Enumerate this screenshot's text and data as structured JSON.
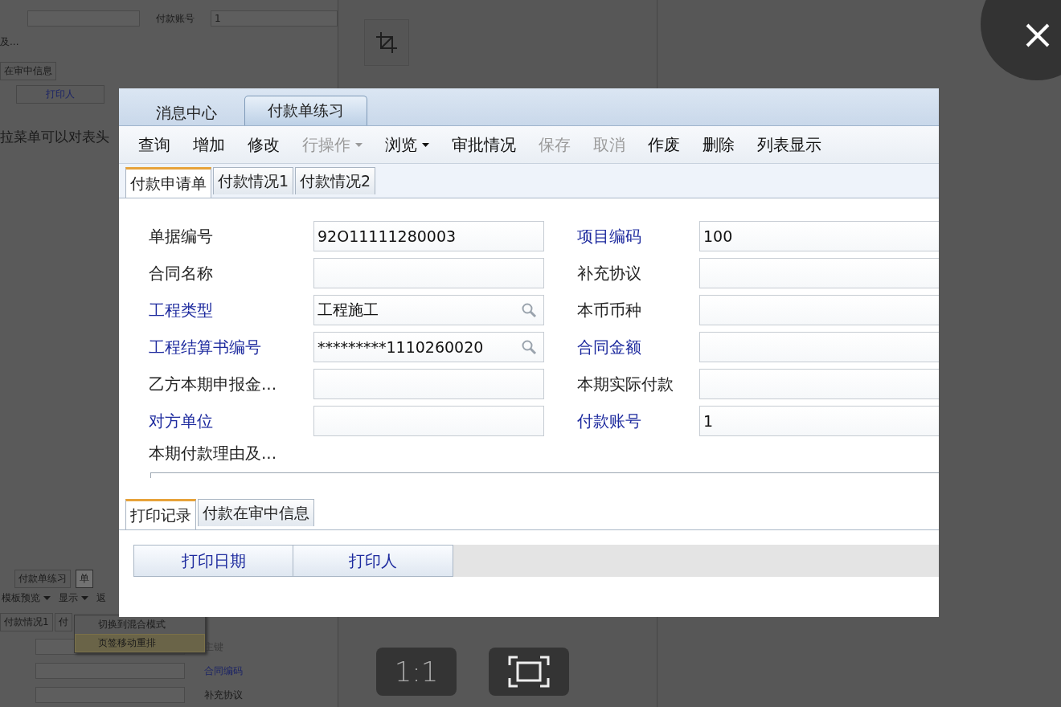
{
  "background_page": {
    "account_label": "付款账号",
    "account_value": "1",
    "remark_fragment": "及...",
    "tab": "在审中信息",
    "column": "打印人",
    "note": "拉菜单可以对表头",
    "tabs": [
      {
        "label": "付款单练习",
        "selected": false
      },
      {
        "label": "单",
        "selected": true
      }
    ],
    "toolbar": [
      {
        "label": "模板预览",
        "dropdown": true
      },
      {
        "label": "显示",
        "dropdown": true
      },
      {
        "label": "返",
        "dropdown": false
      }
    ],
    "form_tabs": [
      "付款情况1",
      "付"
    ],
    "menu": [
      {
        "label": "切换到混合模式",
        "selected": false
      },
      {
        "label": "页签移动重排",
        "selected": true
      }
    ],
    "labels": [
      {
        "text": "主键",
        "kind": "muted"
      },
      {
        "text": "合同编码",
        "kind": "ref"
      },
      {
        "text": "补充协议",
        "kind": "plain"
      }
    ]
  },
  "viewer": {
    "zoom_button": "1:1"
  },
  "image": {
    "doc_tabs": [
      {
        "label": "消息中心",
        "selected": false
      },
      {
        "label": "付款单练习",
        "selected": true
      }
    ],
    "toolbar": [
      {
        "label": "查询",
        "disabled": false,
        "dropdown": false
      },
      {
        "label": "增加",
        "disabled": false,
        "dropdown": false
      },
      {
        "label": "修改",
        "disabled": false,
        "dropdown": false
      },
      {
        "label": "行操作",
        "disabled": true,
        "dropdown": true
      },
      {
        "label": "浏览",
        "disabled": false,
        "dropdown": true
      },
      {
        "label": "审批情况",
        "disabled": false,
        "dropdown": false
      },
      {
        "label": "保存",
        "disabled": true,
        "dropdown": false
      },
      {
        "label": "取消",
        "disabled": true,
        "dropdown": false
      },
      {
        "label": "作废",
        "disabled": false,
        "dropdown": false
      },
      {
        "label": "删除",
        "disabled": false,
        "dropdown": false
      },
      {
        "label": "列表显示",
        "disabled": false,
        "dropdown": false
      }
    ],
    "form_tabs": [
      {
        "label": "付款申请单",
        "selected": true
      },
      {
        "label": "付款情况1",
        "selected": false
      },
      {
        "label": "付款情况2",
        "selected": false
      }
    ],
    "fields": [
      {
        "label": "单据编号",
        "kind": "plain",
        "value": "92O11111280003",
        "lookup": false
      },
      {
        "label": "项目编码",
        "kind": "ref",
        "value": "100",
        "lookup": false
      },
      {
        "label": "合同名称",
        "kind": "plain",
        "lookup": false
      },
      {
        "label": "补充协议",
        "kind": "plain",
        "lookup": false
      },
      {
        "label": "工程类型",
        "kind": "ref",
        "value": "工程施工",
        "lookup": true
      },
      {
        "label": "本币币种",
        "kind": "plain",
        "lookup": false
      },
      {
        "label": "工程结算书编号",
        "kind": "ref",
        "value": "*********1110260020",
        "lookup": true
      },
      {
        "label": "合同金额",
        "kind": "ref",
        "lookup": false
      },
      {
        "label": "乙方本期申报金...",
        "kind": "plain",
        "lookup": false
      },
      {
        "label": "本期实际付款",
        "kind": "plain",
        "lookup": false
      },
      {
        "label": "对方单位",
        "kind": "ref",
        "lookup": false
      },
      {
        "label": "付款账号",
        "kind": "ref",
        "value": "1",
        "lookup": false
      }
    ],
    "remark_label": "本期付款理由及...",
    "bottom_tabs": [
      {
        "label": "打印记录",
        "selected": true
      },
      {
        "label": "付款在审中信息",
        "selected": false
      }
    ],
    "table": {
      "columns": [
        "打印日期",
        "打印人"
      ]
    }
  }
}
